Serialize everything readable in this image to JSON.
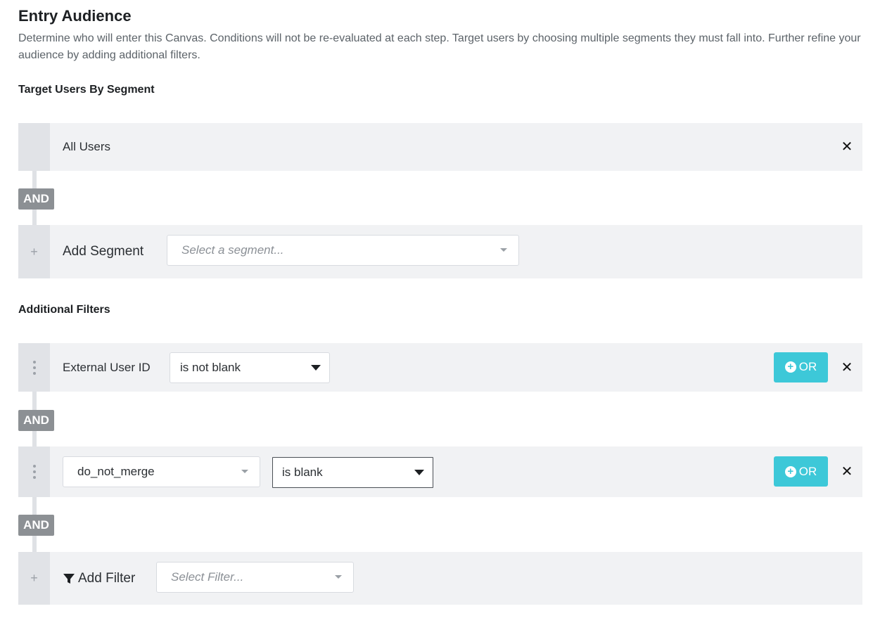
{
  "header": {
    "title": "Entry Audience",
    "description": "Determine who will enter this Canvas. Conditions will not be re-evaluated at each step. Target users by choosing multiple segments they must fall into. Further refine your audience by adding additional filters."
  },
  "segments": {
    "section_title": "Target Users By Segment",
    "items": [
      {
        "label": "All Users"
      }
    ],
    "and_label": "AND",
    "add": {
      "label": "Add Segment",
      "placeholder": "Select a segment..."
    }
  },
  "filters": {
    "section_title": "Additional Filters",
    "and_label": "AND",
    "or_label": "OR",
    "items": [
      {
        "field": "External User ID",
        "operator": "is not blank"
      },
      {
        "field": "do_not_merge",
        "operator": "is blank"
      }
    ],
    "add": {
      "label": "Add Filter",
      "placeholder": "Select Filter..."
    }
  },
  "colors": {
    "accent": "#3dc8d8",
    "and_tag": "#8c9094",
    "row_bg": "#f1f2f4"
  },
  "icons": {
    "remove": "close-icon",
    "drag": "drag-handle-icon",
    "add": "plus-icon",
    "filter": "filter-funnel-icon",
    "dropdown": "chevron-down-icon"
  }
}
